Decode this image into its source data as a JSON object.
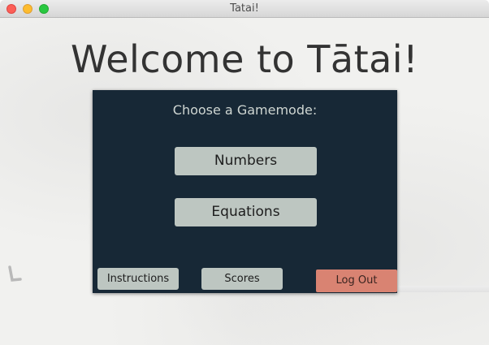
{
  "window": {
    "title": "Tatai!"
  },
  "heading": "Welcome to Tātai!",
  "panel": {
    "title": "Choose a Gamemode:",
    "modes": {
      "numbers_label": "Numbers",
      "equations_label": "Equations"
    },
    "footer": {
      "instructions_label": "Instructions",
      "scores_label": "Scores",
      "logout_label": "Log Out"
    }
  },
  "colors": {
    "panel_bg": "#172836",
    "button_bg": "#bdc6c1",
    "logout_bg": "#d98372",
    "page_bg": "#f1f1ef"
  }
}
